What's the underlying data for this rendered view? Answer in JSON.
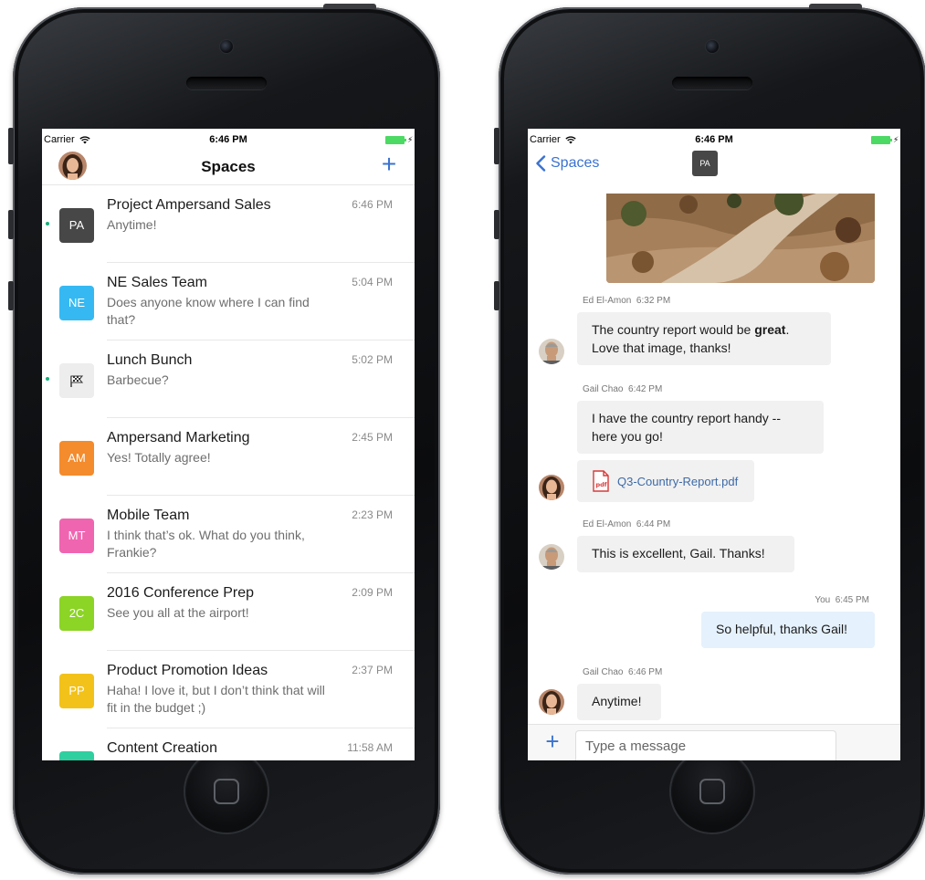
{
  "status_bar": {
    "carrier": "Carrier",
    "time": "6:46 PM",
    "battery_color": "#4cd964"
  },
  "spaces_screen": {
    "title": "Spaces",
    "add_button_label": "+",
    "items": [
      {
        "badge": "PA",
        "badge_color": "#474747",
        "name": "Project Ampersand Sales",
        "preview": "Anytime!",
        "time": "6:46 PM",
        "unread": true
      },
      {
        "badge": "NE",
        "badge_color": "#36b9f2",
        "name": "NE Sales Team",
        "preview": "Does anyone know where I can find that?",
        "time": "5:04 PM",
        "unread": false
      },
      {
        "badge": "flag-icon",
        "badge_color": "#ededed",
        "name": "Lunch Bunch",
        "preview": "Barbecue?",
        "time": "5:02 PM",
        "unread": true
      },
      {
        "badge": "AM",
        "badge_color": "#f48b2c",
        "name": "Ampersand Marketing",
        "preview": "Yes! Totally agree!",
        "time": "2:45 PM",
        "unread": false
      },
      {
        "badge": "MT",
        "badge_color": "#f065b0",
        "name": "Mobile Team",
        "preview": "I think that’s ok. What do you think, Frankie?",
        "time": "2:23 PM",
        "unread": false
      },
      {
        "badge": "2C",
        "badge_color": "#8cd425",
        "name": "2016 Conference Prep",
        "preview": "See you all at the airport!",
        "time": "2:09 PM",
        "unread": false
      },
      {
        "badge": "PP",
        "badge_color": "#f2c21a",
        "name": "Product Promotion Ideas",
        "preview": "Haha! I love it, but I don’t think that will fit in the budget ;)",
        "time": "2:37 PM",
        "unread": false
      },
      {
        "badge": "",
        "badge_color": "#2fcfa0",
        "name": "Content Creation",
        "preview": "",
        "time": "11:58 AM",
        "unread": false
      }
    ]
  },
  "chat_screen": {
    "back_label": "Spaces",
    "space_badge": "PA",
    "messages": [
      {
        "sender": "Ed El-Amon",
        "time": "6:32 PM",
        "text_before": "The country report would be ",
        "text_bold": "great",
        "text_after": ".\nLove that image, thanks!"
      },
      {
        "sender": "Gail Chao",
        "time": "6:42 PM",
        "text": "I have the country report handy --\nhere you go!",
        "file_name": "Q3-Country-Report.pdf",
        "file_icon": "pdf-icon"
      },
      {
        "sender": "Ed El-Amon",
        "time": "6:44 PM",
        "text": "This is excellent, Gail. Thanks!"
      },
      {
        "sender": "You",
        "time": "6:45 PM",
        "text": "So helpful, thanks Gail!"
      },
      {
        "sender": "Gail Chao",
        "time": "6:46 PM",
        "text": "Anytime!"
      }
    ],
    "composer": {
      "placeholder": "Type a message",
      "value": "",
      "add_label": "+"
    }
  },
  "colors": {
    "accent": "#3a72d0",
    "unread_dot": "#17b07a",
    "my_bubble": "#e5f1fc",
    "their_bubble": "#f1f1f1"
  }
}
